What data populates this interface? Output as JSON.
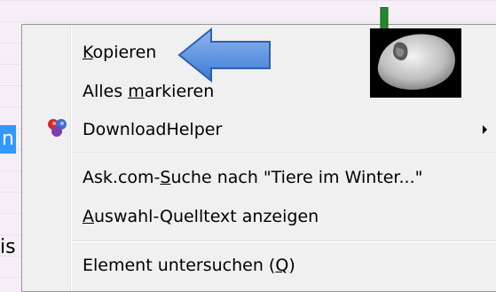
{
  "background": {
    "selected_fragment": "n",
    "plain_fragment": "is"
  },
  "menu": {
    "items": [
      {
        "label_pre": "",
        "label_u": "K",
        "label_post": "opieren",
        "submenu": false
      },
      {
        "label_pre": "Alles ",
        "label_u": "m",
        "label_post": "arkieren",
        "submenu": false
      },
      {
        "label_pre": "DownloadHelper",
        "label_u": "",
        "label_post": "",
        "submenu": true,
        "icon": "downloadhelper-icon"
      },
      {
        "label_pre": "Ask.com-",
        "label_u": "S",
        "label_post": "uche nach \"Tiere im Winter...\"",
        "submenu": false
      },
      {
        "label_pre": "",
        "label_u": "A",
        "label_post": "uswahl-Quelltext anzeigen",
        "submenu": false
      },
      {
        "label_pre": "Element untersuchen (",
        "label_u": "Q",
        "label_post": ")",
        "submenu": false
      }
    ]
  },
  "colors": {
    "menu_bg": "#f0f0f0",
    "selection_bg": "#3399ff",
    "arrow_blue": "#4f8fe0",
    "arrow_green": "#1f8a2a"
  },
  "annotations": {
    "blue_arrow_icon": "left-arrow-icon",
    "green_arrow_icon": "down-arrow-icon",
    "mouse_picture": "computer-mouse-icon"
  }
}
